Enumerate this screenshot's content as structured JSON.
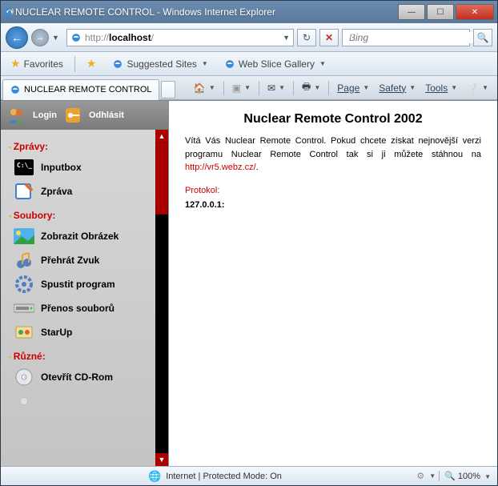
{
  "window": {
    "title": "NUCLEAR REMOTE CONTROL - Windows Internet Explorer"
  },
  "nav": {
    "url_prefix": "http://",
    "url_host": "localhost",
    "url_suffix": "/"
  },
  "search": {
    "placeholder": "Bing"
  },
  "favbar": {
    "favorites": "Favorites",
    "suggested": "Suggested Sites",
    "webslice": "Web Slice Gallery"
  },
  "tab": {
    "title": "NUCLEAR REMOTE CONTROL"
  },
  "cmdbar": {
    "page": "Page",
    "safety": "Safety",
    "tools": "Tools"
  },
  "sidebar": {
    "login": "Login",
    "logout": "Odhlásit",
    "sections": {
      "zpravy": "Zprávy:",
      "soubory": "Soubory:",
      "ruzne": "Různé:"
    },
    "items": {
      "inputbox": "Inputbox",
      "zprava": "Zpráva",
      "obrazek": "Zobrazit Obrázek",
      "zvuk": "Přehrát Zvuk",
      "spustit": "Spustit program",
      "prenos": "Přenos souborů",
      "startup": "StarUp",
      "cdrom": "Otevřít CD-Rom"
    }
  },
  "main": {
    "heading": "Nuclear Remote Control 2002",
    "intro": "Vítá Vás Nuclear Remote Control. Pokud chcete získat nejnovější verzi programu Nuclear Remote Control tak si ji můžete stáhnou na  ",
    "link_text": "http://vr5.webz.cz/",
    "protokol_label": "Protokol:",
    "protokol_value": "127.0.0.1:"
  },
  "status": {
    "text": "Internet | Protected Mode: On",
    "zoom": "100%"
  }
}
